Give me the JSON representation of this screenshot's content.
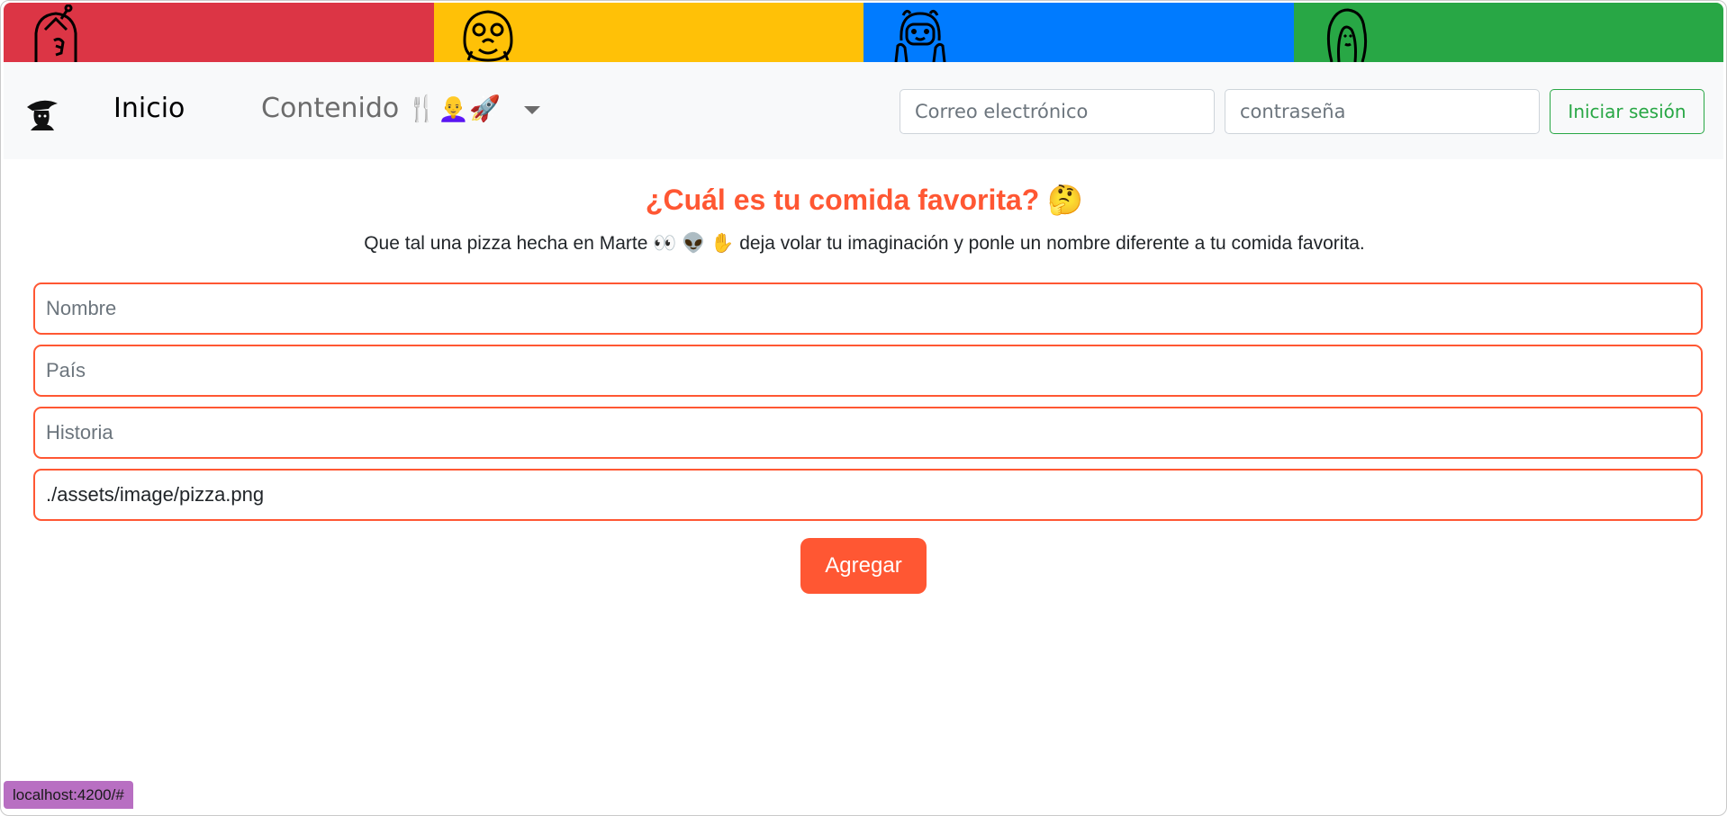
{
  "banner": {
    "colors": [
      "#dc3545",
      "#ffc107",
      "#007bff",
      "#28a745"
    ],
    "icons": [
      "princess-bubblegum-icon",
      "jake-dog-icon",
      "finn-human-icon",
      "marceline-icon"
    ]
  },
  "navbar": {
    "brand_icon": "hat-character-icon",
    "home_label": "Inicio",
    "content_label": "Contenido",
    "content_emojis": "🍴👩‍🦲🚀",
    "dropdown_icon": "caret-down-icon"
  },
  "login": {
    "email_placeholder": "Correo electrónico",
    "password_placeholder": "contraseña",
    "submit_label": "Iniciar sesión"
  },
  "main": {
    "title": "¿Cuál es tu comida favorita? 🤔",
    "subtitle": "Que tal una pizza hecha en Marte 👀 👽 ✋ deja volar tu imaginación y ponle un nombre diferente a tu comida favorita.",
    "form": {
      "name_placeholder": "Nombre",
      "country_placeholder": "País",
      "story_placeholder": "Historia",
      "image_value": "./assets/image/pizza.png",
      "submit_label": "Agregar"
    }
  },
  "status_bar": {
    "url": "localhost:4200/#"
  },
  "colors": {
    "accent": "#ff5733",
    "success": "#28a745"
  }
}
